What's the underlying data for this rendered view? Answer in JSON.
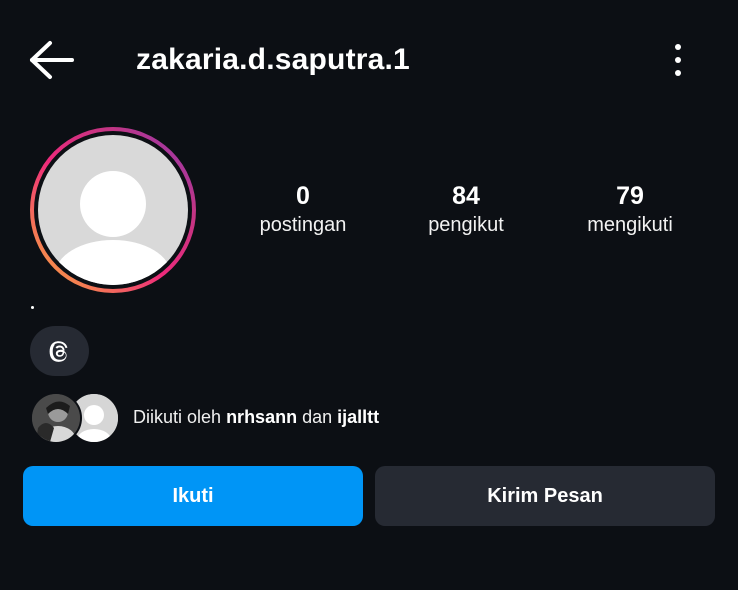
{
  "header": {
    "back_icon": "arrow-left-icon",
    "username": "zakaria.d.saputra.1",
    "more_icon": "more-vertical-icon"
  },
  "profile": {
    "avatar_icon": "default-avatar-icon",
    "story_ring_colors": [
      "#f9b13a",
      "#ee2a7b",
      "#c13584",
      "#8a3ab9"
    ],
    "bio": "."
  },
  "stats": {
    "posts": {
      "value": "0",
      "label": "postingan"
    },
    "followers": {
      "value": "84",
      "label": "pengikut"
    },
    "following": {
      "value": "79",
      "label": "mengikuti"
    }
  },
  "threads_link": {
    "icon": "threads-icon"
  },
  "followed_by": {
    "prefix": "Diikuti oleh",
    "user1": "nrhsann",
    "conjunction": "dan",
    "user2": "ijalltt"
  },
  "actions": {
    "follow_label": "Ikuti",
    "message_label": "Kirim Pesan"
  },
  "colors": {
    "background": "#0c0f14",
    "primary_button": "#0095f6",
    "secondary_button": "#262a33"
  }
}
